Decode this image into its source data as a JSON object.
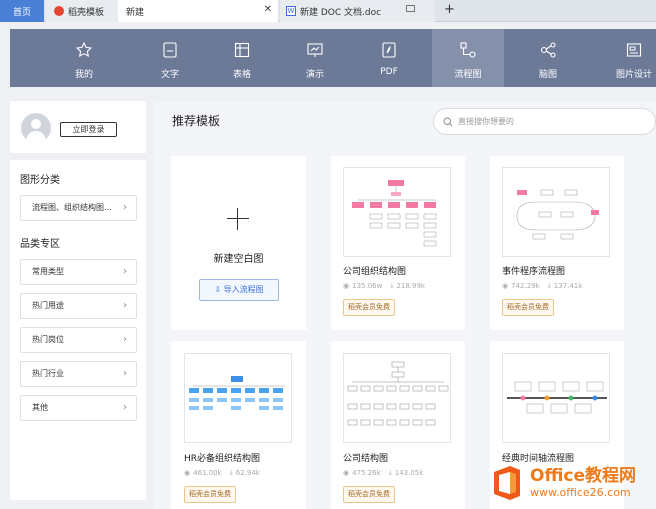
{
  "tabs": {
    "home": "首页",
    "daoke": "稻壳模板",
    "new": "新建",
    "doc": "新建 DOC 文档.doc"
  },
  "nav": [
    {
      "label": "我的",
      "icon": "star-icon"
    },
    {
      "label": "文字",
      "icon": "text-doc-icon"
    },
    {
      "label": "表格",
      "icon": "table-icon"
    },
    {
      "label": "演示",
      "icon": "presentation-icon"
    },
    {
      "label": "PDF",
      "icon": "pdf-icon"
    },
    {
      "label": "流程图",
      "icon": "flowchart-icon"
    },
    {
      "label": "脑图",
      "icon": "mindmap-icon"
    },
    {
      "label": "图片设计",
      "icon": "image-design-icon"
    }
  ],
  "sidebar": {
    "login_label": "立即登录",
    "shape_category_title": "图形分类",
    "shape_category_item": "流程图、组织结构图...",
    "zone_title": "品类专区",
    "zone_items": [
      "常用类型",
      "热门用途",
      "热门岗位",
      "热门行业",
      "其他"
    ]
  },
  "main": {
    "title": "推荐模板",
    "search_placeholder": "直接搜你想要的",
    "new_blank": {
      "label": "新建空白图",
      "import_label": "导入流程图"
    },
    "cards": [
      {
        "title": "公司组织结构图",
        "views": "135.06w",
        "downloads": "218.99k",
        "badge": "稻壳会员免费"
      },
      {
        "title": "事件程序流程图",
        "views": "742.29k",
        "downloads": "137.41k",
        "badge": "稻壳会员免费"
      },
      {
        "title": "HR必备组织结构图",
        "views": "461.00k",
        "downloads": "62.94k",
        "badge": "稻壳会员免费"
      },
      {
        "title": "公司结构图",
        "views": "475.26k",
        "downloads": "143.05k",
        "badge": "稻壳会员免费"
      },
      {
        "title": "经典时间轴流程图",
        "views": "",
        "downloads": "",
        "badge": ""
      }
    ]
  },
  "watermark": {
    "line1": "Office教程网",
    "line2": "www.office26.com"
  },
  "colors": {
    "nav_bg": "#6c7a98",
    "nav_active": "#8591ab",
    "accent_blue": "#3b6fd6",
    "badge_orange": "#f0c58a",
    "watermark_orange": "#ef7a1a"
  }
}
